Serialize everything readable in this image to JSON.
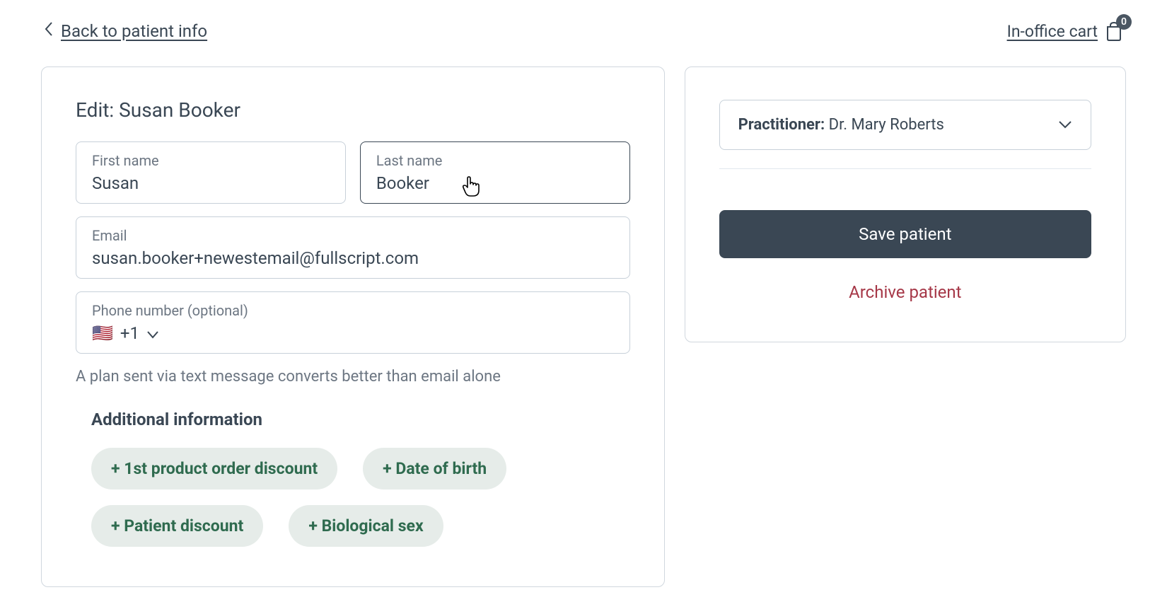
{
  "topbar": {
    "back_label": "Back to patient info",
    "cart_label": "In-office cart",
    "cart_count": "0"
  },
  "form": {
    "heading": "Edit: Susan Booker",
    "first_name": {
      "label": "First name",
      "value": "Susan"
    },
    "last_name": {
      "label": "Last name",
      "value": "Booker"
    },
    "email": {
      "label": "Email",
      "value": "susan.booker+newestemail@fullscript.com"
    },
    "phone": {
      "label": "Phone number (optional)",
      "flag": "🇺🇸",
      "prefix": "+1",
      "value": ""
    },
    "phone_helper": "A plan sent via text message converts better than email alone",
    "additional_title": "Additional information",
    "chips": [
      "+ 1st product order discount",
      "+ Date of birth",
      "+ Patient discount",
      "+ Biological sex"
    ]
  },
  "sidebar": {
    "practitioner_label": "Practitioner",
    "practitioner_value": "Dr. Mary Roberts",
    "save_label": "Save patient",
    "archive_label": "Archive patient"
  }
}
